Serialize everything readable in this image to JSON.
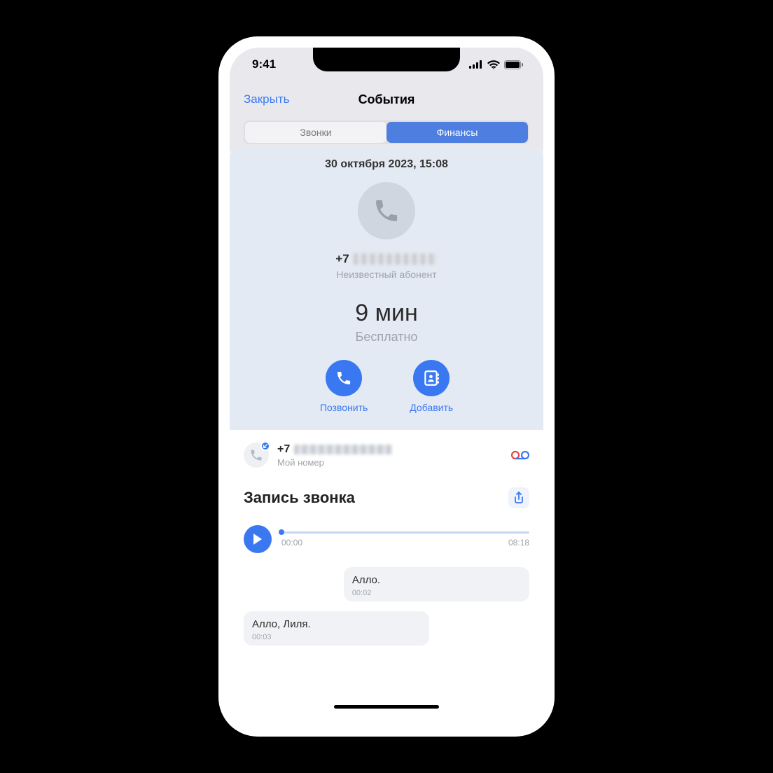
{
  "status": {
    "time": "9:41"
  },
  "nav": {
    "close": "Закрыть",
    "title": "События"
  },
  "tabs": {
    "calls": "Звонки",
    "finance": "Финансы"
  },
  "event": {
    "datetime": "30 октября 2023, 15:08",
    "phone_prefix": "+7",
    "caller_label": "Неизвестный абонент",
    "duration": "9 мин",
    "cost": "Бесплатно"
  },
  "actions": {
    "call": "Позвонить",
    "add": "Добавить"
  },
  "my_line": {
    "prefix": "+7",
    "label": "Мой номер"
  },
  "recording": {
    "title": "Запись звонка",
    "start": "00:00",
    "end": "08:18"
  },
  "transcript": [
    {
      "side": "right",
      "text": "Алло.",
      "time": "00:02"
    },
    {
      "side": "left",
      "text": "Алло, Лиля.",
      "time": "00:03"
    }
  ],
  "colors": {
    "accent": "#3a78f2"
  }
}
